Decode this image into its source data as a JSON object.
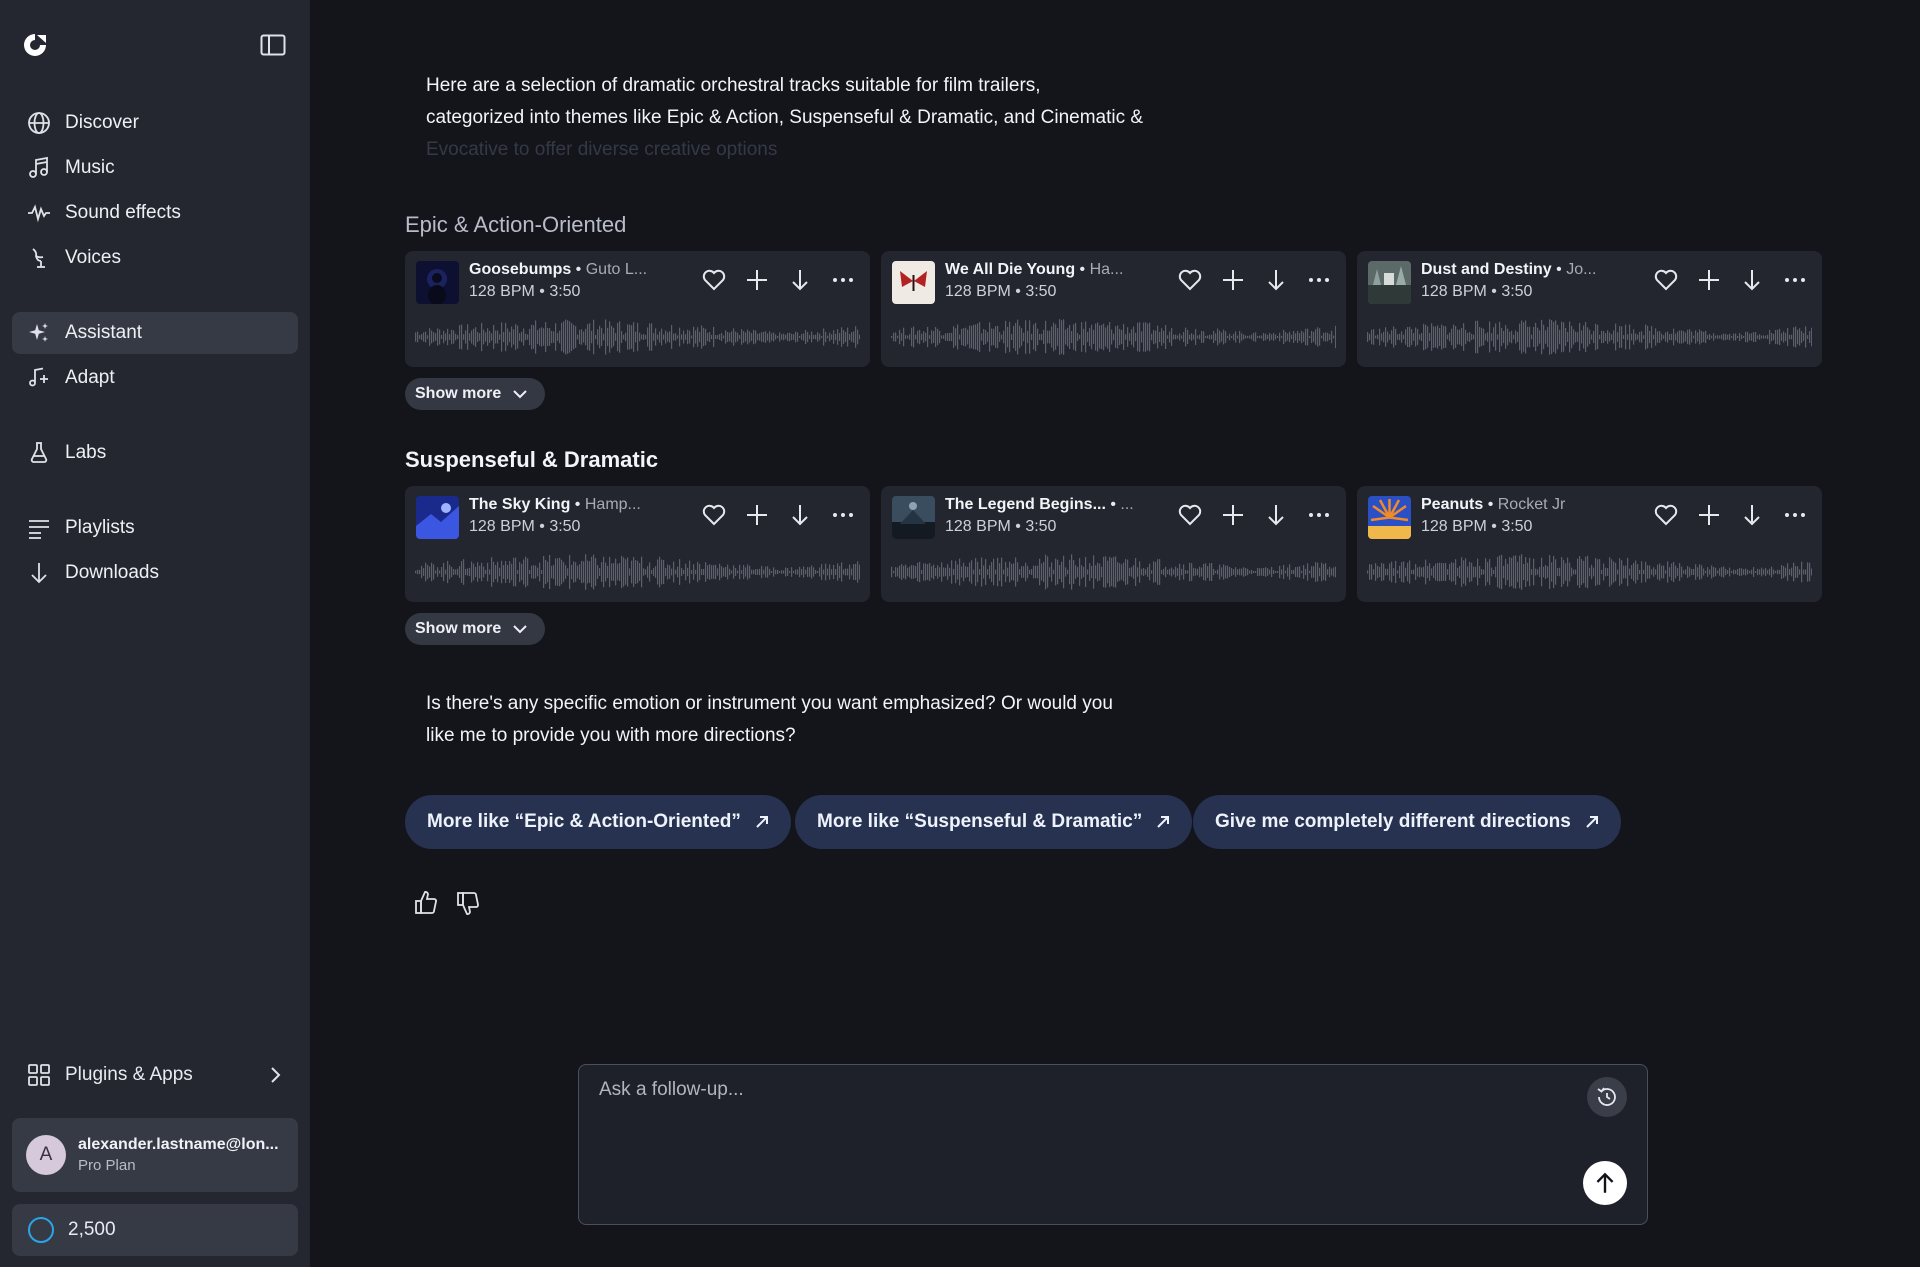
{
  "sidebar": {
    "nav_top": [
      {
        "label": "Discover",
        "icon": "globe-icon"
      },
      {
        "label": "Music",
        "icon": "music-note-icon"
      },
      {
        "label": "Sound effects",
        "icon": "waveform-icon"
      },
      {
        "label": "Voices",
        "icon": "microphone-icon"
      }
    ],
    "nav_mid": [
      {
        "label": "Assistant",
        "icon": "sparkle-icon"
      },
      {
        "label": "Adapt",
        "icon": "adapt-icon"
      }
    ],
    "labs": {
      "label": "Labs",
      "icon": "flask-icon"
    },
    "nav_bottom": [
      {
        "label": "Playlists",
        "icon": "list-icon"
      },
      {
        "label": "Downloads",
        "icon": "download-icon"
      }
    ],
    "plugins": {
      "label": "Plugins & Apps"
    },
    "account": {
      "initial": "A",
      "email": "alexander.lastname@lon...",
      "plan": "Pro Plan"
    },
    "credits": {
      "value": "2,500"
    }
  },
  "intro": {
    "line1": "Here are a selection of dramatic orchestral tracks suitable for film trailers,",
    "line2": "categorized into themes like Epic & Action, Suspenseful & Dramatic, and Cinematic &",
    "line3": "Evocative to offer diverse creative options"
  },
  "sections": [
    {
      "title": "Epic & Action-Oriented",
      "show_more": "Show more",
      "tracks": [
        {
          "name": "Goosebumps",
          "artist": "Guto L...",
          "bpm": "128 BPM",
          "duration": "3:50"
        },
        {
          "name": "We All Die Young",
          "artist": "Ha...",
          "bpm": "128 BPM",
          "duration": "3:50"
        },
        {
          "name": "Dust and Destiny",
          "artist": "Jo...",
          "bpm": "128 BPM",
          "duration": "3:50"
        }
      ]
    },
    {
      "title": "Suspenseful & Dramatic",
      "show_more": "Show more",
      "tracks": [
        {
          "name": "The Sky King",
          "artist": "Hamp...",
          "bpm": "128 BPM",
          "duration": "3:50"
        },
        {
          "name": "The Legend Begins...",
          "artist": "...",
          "bpm": "128 BPM",
          "duration": "3:50"
        },
        {
          "name": "Peanuts",
          "artist": "Rocket Jr",
          "bpm": "128 BPM",
          "duration": "3:50"
        }
      ]
    }
  ],
  "question": {
    "line1": " Is there's any specific emotion or instrument you want emphasized? Or would you",
    "line2": "like me to provide you with more directions?"
  },
  "suggestions": [
    "More like “Epic & Action-Oriented”",
    "More like “Suspenseful & Dramatic”",
    "Give me completely different directions"
  ],
  "composer": {
    "placeholder": "Ask a follow-up..."
  },
  "colors": {
    "accent_chip": "#263250",
    "credit_ring": "#2aa6e6",
    "sidebar_bg": "#24272f",
    "main_bg": "#13151b"
  }
}
